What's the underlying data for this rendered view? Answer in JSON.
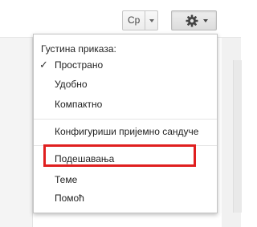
{
  "toolbar": {
    "language_label": "Ср"
  },
  "menu": {
    "density_header": "Густина приказа:",
    "density_options": [
      {
        "label": "Пространo",
        "checked": true
      },
      {
        "label": "Удобно",
        "checked": false
      },
      {
        "label": "Компактно",
        "checked": false
      }
    ],
    "configure_inbox": "Конфигуриши пријемно сандуче",
    "settings": "Подешавања",
    "themes": "Теме",
    "help": "Помоћ"
  },
  "icons": {
    "gear": "gear-icon",
    "check": "checkmark-icon",
    "caret": "chevron-down-icon"
  },
  "colors": {
    "highlight": "#e01f1f"
  }
}
